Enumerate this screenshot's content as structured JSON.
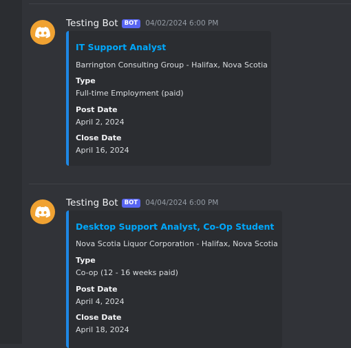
{
  "messages": [
    {
      "username": "Testing Bot",
      "badge": "BOT",
      "timestamp": "04/02/2024 6:00 PM",
      "avatar_icon": "discord-logo-icon",
      "embed": {
        "title": "IT Support Analyst",
        "description": "Barrington Consulting Group - Halifax, Nova Scotia",
        "fields": [
          {
            "name": "Type",
            "value": "Full-time Employment (paid)"
          },
          {
            "name": "Post Date",
            "value": "April 2, 2024"
          },
          {
            "name": "Close Date",
            "value": "April 16, 2024"
          }
        ]
      }
    },
    {
      "username": "Testing Bot",
      "badge": "BOT",
      "timestamp": "04/04/2024 6:00 PM",
      "avatar_icon": "discord-logo-icon",
      "embed": {
        "title": "Desktop Support Analyst, Co-Op Student",
        "description": "Nova Scotia Liquor Corporation - Halifax, Nova Scotia",
        "fields": [
          {
            "name": "Type",
            "value": "Co-op (12 - 16 weeks paid)"
          },
          {
            "name": "Post Date",
            "value": "April 4, 2024"
          },
          {
            "name": "Close Date",
            "value": "April 18, 2024"
          }
        ]
      }
    }
  ],
  "colors": {
    "background": "#313338",
    "embed_background": "#2b2d31",
    "embed_accent": "#1e88e5",
    "link": "#00a8fc",
    "avatar": "#f0a232",
    "badge": "#5865f2"
  }
}
